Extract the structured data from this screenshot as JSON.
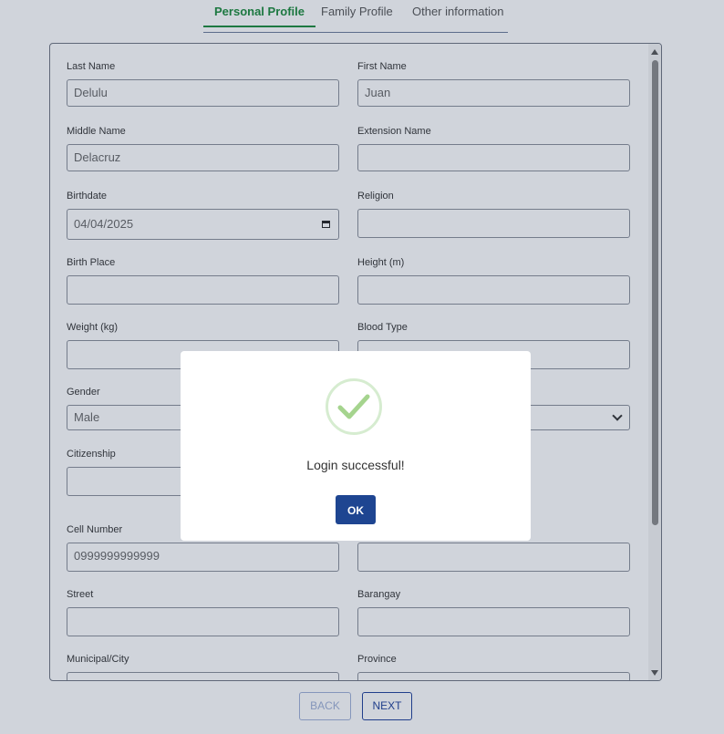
{
  "tabs": [
    "Personal Profile",
    "Family Profile",
    "Other information"
  ],
  "form": {
    "last_name": {
      "label": "Last Name",
      "value": "Delulu"
    },
    "first_name": {
      "label": "First Name",
      "value": "Juan"
    },
    "middle_name": {
      "label": "Middle Name",
      "value": "Delacruz"
    },
    "extension_name": {
      "label": "Extension Name",
      "value": ""
    },
    "birthdate": {
      "label": "Birthdate",
      "value": "04/04/2025"
    },
    "religion": {
      "label": "Religion",
      "value": ""
    },
    "birth_place": {
      "label": "Birth Place",
      "value": ""
    },
    "height": {
      "label": "Height (m)",
      "value": ""
    },
    "weight": {
      "label": "Weight (kg)",
      "value": ""
    },
    "blood_type": {
      "label": "Blood Type",
      "value": ""
    },
    "gender": {
      "label": "Gender",
      "value": "Male"
    },
    "civil_status": {
      "value": ""
    },
    "citizenship": {
      "label": "Citizenship",
      "value": ""
    },
    "cell_number": {
      "label": "Cell Number",
      "value": "0999999999999"
    },
    "email": {
      "value": ""
    },
    "street": {
      "label": "Street",
      "value": ""
    },
    "barangay": {
      "label": "Barangay",
      "value": ""
    },
    "municipal": {
      "label": "Municipal/City",
      "value": ""
    },
    "province": {
      "label": "Province",
      "value": ""
    }
  },
  "nav": {
    "back": "BACK",
    "next": "NEXT"
  },
  "modal": {
    "message": "Login successful!",
    "ok": "OK"
  },
  "colors": {
    "active_tab": "#1a8a3a",
    "primary_button": "#1e4591",
    "success_ring": "#d6ecd0",
    "success_check": "#a5d48e"
  }
}
